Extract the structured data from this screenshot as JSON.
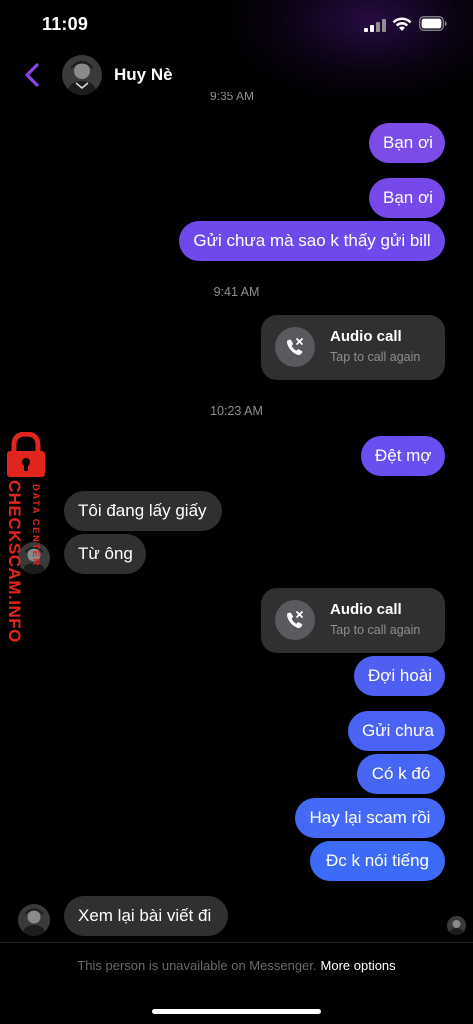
{
  "status_bar": {
    "time": "11:09"
  },
  "header": {
    "contact_name": "Huy Nè"
  },
  "cut_timestamp": "9:35 AM",
  "messages": {
    "m1": "Bạn ơi",
    "m2": "Bạn ơi",
    "m3": "Gửi chưa mà sao k thấy gửi bill",
    "ts1": "9:41 AM",
    "call1_title": "Audio call",
    "call1_sub": "Tap to call again",
    "ts2": "10:23 AM",
    "m4": "Đệt mợ",
    "m5": "Tôi đang lấy giấy",
    "m6": "Từ ông",
    "call2_title": "Audio call",
    "call2_sub": "Tap to call again",
    "m7": "Đợi hoài",
    "m8": "Gửi chưa",
    "m9": "Có k đó",
    "m10": "Hay lại scam rồi",
    "m11": "Đc k nói tiếng",
    "m12": "Xem lại bài viết đi"
  },
  "footer": {
    "message": "This person is unavailable on Messenger.",
    "link": "More options"
  },
  "watermark": {
    "main": "CHECKSCAM.INFO",
    "sub": "DATA CENTER"
  },
  "colors": {
    "bubble_purple": "#7b4ce8",
    "bubble_violet": "#6a4ff0",
    "bubble_blue": "#4f63f5",
    "bubble_blue_deep": "#3d6bf7",
    "incoming": "#303030",
    "accent_back": "#8a46e8",
    "watermark_red": "#e0261c"
  },
  "icons": {
    "back": "chevron-left-icon",
    "call": "missed-call-icon",
    "lock": "padlock-icon"
  }
}
